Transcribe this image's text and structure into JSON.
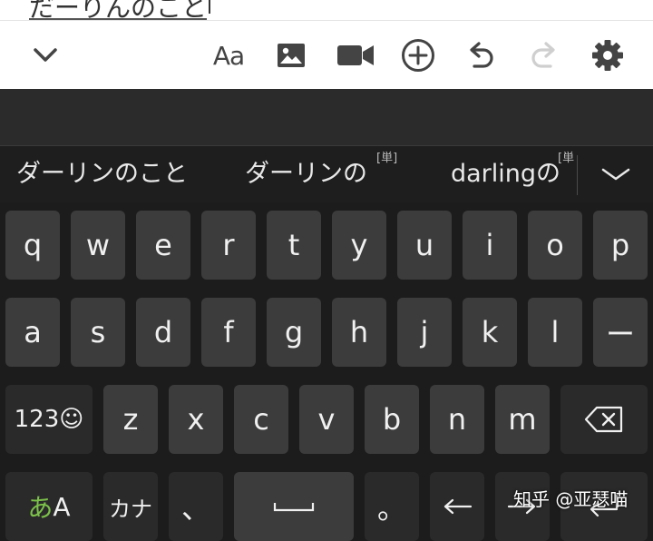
{
  "editor": {
    "text": "だーりんのこと"
  },
  "toolbar": {
    "items": [
      {
        "name": "collapse",
        "icon": "chevron-down-icon"
      },
      {
        "name": "font",
        "label": "Aa",
        "icon": "text-format-icon"
      },
      {
        "name": "image",
        "icon": "image-icon"
      },
      {
        "name": "video",
        "icon": "video-camera-icon"
      },
      {
        "name": "insert",
        "icon": "plus-circle-icon"
      },
      {
        "name": "undo",
        "icon": "undo-icon"
      },
      {
        "name": "redo",
        "icon": "redo-icon",
        "disabled": true
      },
      {
        "name": "settings",
        "icon": "gear-icon"
      }
    ]
  },
  "candidates": {
    "items": [
      {
        "text": "ダーリンのこと"
      },
      {
        "text": "ダーリンの",
        "tag": "[単]"
      },
      {
        "text": "darlingの",
        "tag": "[単"
      }
    ],
    "expand_icon": "chevron-down-icon"
  },
  "keyboard": {
    "row1": [
      "q",
      "w",
      "e",
      "r",
      "t",
      "y",
      "u",
      "i",
      "o",
      "p"
    ],
    "row2": [
      "a",
      "s",
      "d",
      "f",
      "g",
      "h",
      "j",
      "k",
      "l",
      "ー"
    ],
    "row3": {
      "mode_label": "123☺",
      "letters": [
        "z",
        "x",
        "c",
        "v",
        "b",
        "n",
        "m"
      ],
      "backspace_icon": "backspace-icon"
    },
    "row4": {
      "lang_hira": "あ",
      "lang_alpha": "A",
      "kana": "カナ",
      "comma": "、",
      "space_icon": "space-bar-icon",
      "period": "。",
      "left_icon": "arrow-left-icon",
      "right_icon": "arrow-right-icon",
      "enter_icon": "enter-icon"
    }
  },
  "watermark": {
    "text": "知乎 @亚瑟喵"
  },
  "colors": {
    "accent_green": "#7cc24a",
    "key_bg": "#3c3c3c",
    "keyboard_bg": "#1c1c1c"
  }
}
